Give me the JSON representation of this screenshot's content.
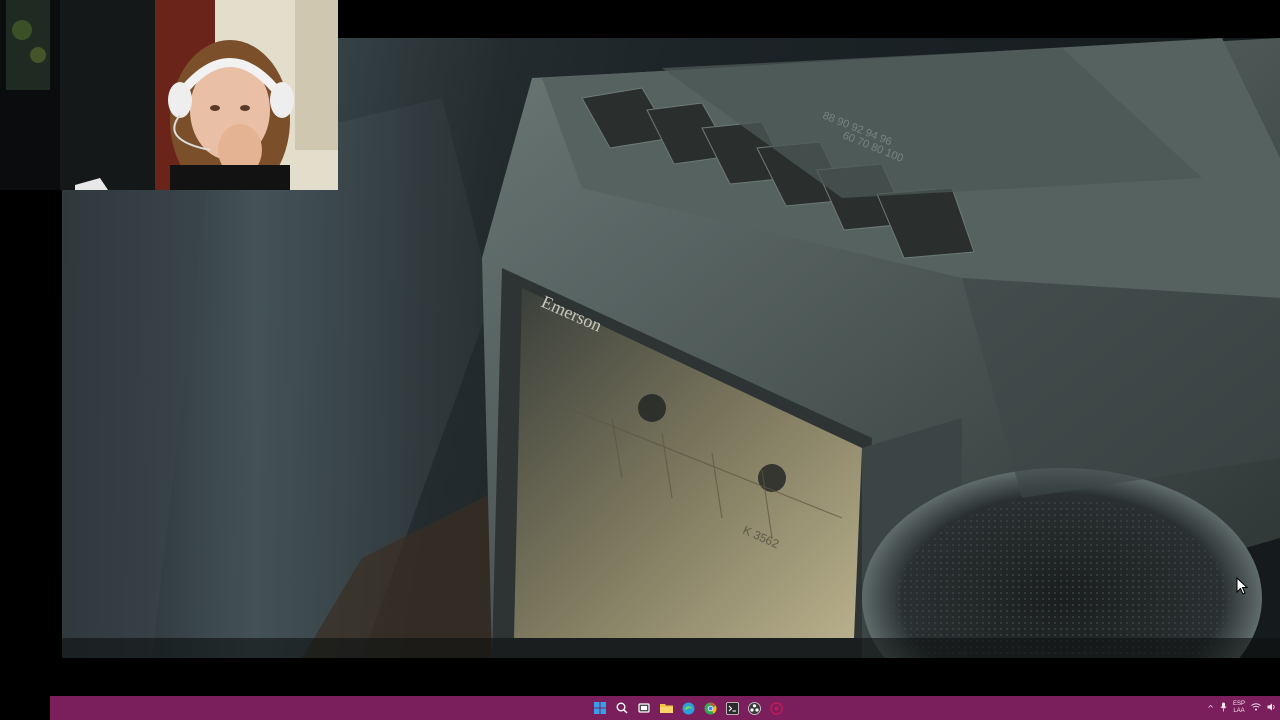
{
  "video": {
    "brand_text": "Emerson",
    "model_text": "K 3562"
  },
  "taskbar": {
    "color": "#7a1f5c",
    "apps": [
      {
        "name": "start-icon",
        "color": "#3a9ee8"
      },
      {
        "name": "search-icon",
        "color": "#ffffff"
      },
      {
        "name": "task-view-icon",
        "color": "#ffffff"
      },
      {
        "name": "file-explorer-icon",
        "color": "#f4c542"
      },
      {
        "name": "edge-icon",
        "color": "#2b9fd9"
      },
      {
        "name": "chrome-icon",
        "color": "#f2b400"
      },
      {
        "name": "terminal-icon",
        "color": "#2b2b2b"
      },
      {
        "name": "obs-icon",
        "color": "#3b3b3b"
      },
      {
        "name": "app-icon",
        "color": "#c2185b"
      }
    ],
    "tray": {
      "chevron": "^",
      "language_top": "ESP",
      "language_bottom": "LAA"
    }
  }
}
